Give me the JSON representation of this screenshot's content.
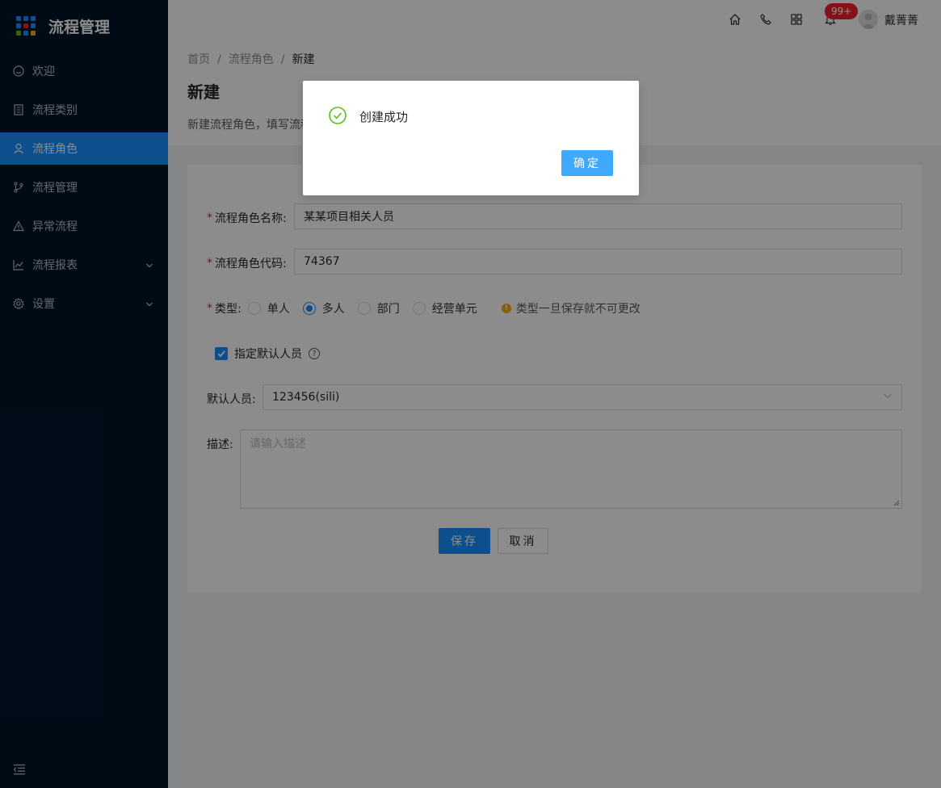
{
  "app": {
    "title": "流程管理"
  },
  "sidebar": {
    "items": [
      {
        "label": "欢迎",
        "icon": "smile-icon"
      },
      {
        "label": "流程类别",
        "icon": "book-icon"
      },
      {
        "label": "流程角色",
        "icon": "user-icon",
        "active": true
      },
      {
        "label": "流程管理",
        "icon": "branch-icon"
      },
      {
        "label": "异常流程",
        "icon": "warning-icon"
      },
      {
        "label": "流程报表",
        "icon": "line-chart-icon",
        "expandable": true
      },
      {
        "label": "设置",
        "icon": "gear-icon",
        "expandable": true
      }
    ]
  },
  "header": {
    "notification_count": "99+",
    "username": "戴菁菁"
  },
  "breadcrumb": [
    "首页",
    "流程角色",
    "新建"
  ],
  "page": {
    "title": "新建",
    "description": "新建流程角色，填写流程"
  },
  "form": {
    "role_name_label": "流程角色名称:",
    "role_name_value": "某某项目相关人员",
    "role_code_label": "流程角色代码:",
    "role_code_value": "74367",
    "type_label": "类型:",
    "type_options": [
      "单人",
      "多人",
      "部门",
      "经营单元"
    ],
    "type_selected": "多人",
    "type_hint": "类型一旦保存就不可更改",
    "default_person_checkbox": "指定默认人员",
    "default_person_label": "默认人员:",
    "default_person_value": "123456(sili)",
    "description_label": "描述:",
    "description_placeholder": "请输入描述",
    "save_label": "保存",
    "cancel_label": "取消"
  },
  "modal": {
    "title": "创建成功",
    "ok_label": "确定"
  },
  "colors": {
    "sidebar_bg": "#001529",
    "primary": "#1890ff",
    "success": "#52c41a",
    "danger": "#f5222d",
    "warning": "#faad14"
  }
}
